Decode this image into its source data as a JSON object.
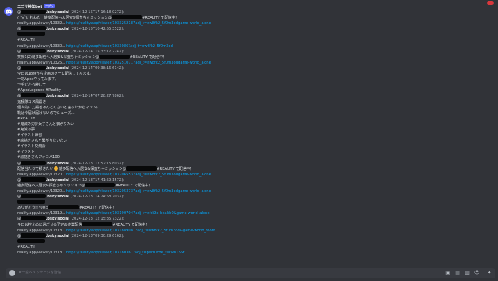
{
  "notification_badge": "",
  "bot": {
    "name": "エゴサ検知bot",
    "badge": "アプリ",
    "time": ""
  },
  "input": {
    "placeholder": "#一般へメッセージを送信"
  },
  "icons": [
    "discord-icon",
    "plus-icon",
    "gift-icon",
    "gif-icon",
    "sticker-icon",
    "emoji-icon",
    "apps-icon"
  ],
  "colors": {
    "accent": "#5865f2",
    "link": "#00a8fc",
    "background": "#313338"
  },
  "messages": [
    {
      "lines": [
        {
          "handle": ".bsky.social",
          "meta": "(2024-12-15T17:16:18.027Z):"
        },
        {
          "text": "( ´∀`)/ おわたー雑多配信へ入居安&探査ちゃミッション@",
          "text2": "#REALITY で配信中！"
        },
        {
          "prefix": "reality.app/viewer/10332...",
          "link": "https://reality.app/viewer/1033252187adj_t=nw8fk2_5f0m3odgame-world_alone"
        },
        {
          "handle": ".bsky.social",
          "meta": "(2024-12-15T10:42:55.352Z):"
        },
        {
          "text": ""
        },
        {
          "text": "#REALITY"
        },
        {
          "prefix": "reality.app/viewer/10330...",
          "link": "https://reality.app/viewer/1033086?adj_t=nw8fk2_5f0m3od"
        }
      ]
    },
    {
      "lines": [
        {
          "handle": ".bsky.social",
          "meta": "(2024-12-14T15:33:17.224Z):"
        },
        {
          "text": "笑顔1(2)雑多配信へ入居安&探査ちゃミッション@",
          "text2": "#REALITY で配信中！"
        },
        {
          "prefix": "reality.app/viewer/10325...",
          "link": "https://reality.app/viewer/1032510717adj_t=nw8fk2_5f0m3odgame-world_alone"
        },
        {
          "handle": ".bsky.social",
          "meta": "(2024-12-14T09:38:16.614Z):"
        },
        {
          "text": "今日は18時から企画のゲーム配信してみます。"
        },
        {
          "text": "一応Apexやってみます。"
        },
        {
          "text": "下手だから許して"
        },
        {
          "text": "#ApexLegends #Reality"
        },
        {
          "handle": ".bsky.social",
          "meta": "(2024-12-14T07:28:27.786Z):"
        },
        {
          "text": "鬼殺隊コス風置き"
        },
        {
          "text": "個人的に刀鍛冶あんどくさいと言ったからマントに"
        },
        {
          "text": "靴は今届け届けないのでシューズ…"
        },
        {
          "text": "#REALITY"
        },
        {
          "text": "#鬼滅の刃夢女子さんと繋がりたい"
        },
        {
          "text": "#鬼滅の夢"
        },
        {
          "text": "#イラスト練習"
        },
        {
          "text": "#絵描きさんと繋がりたいたい"
        },
        {
          "text": "#イラスト交流会"
        },
        {
          "text": "#イラスト"
        },
        {
          "text": "#絵描きさんフォロバ100"
        }
      ]
    },
    {
      "lines": [
        {
          "handle": ".bsky.social",
          "meta": "(2024-12-13T17:52:15.803Z):"
        },
        {
          "text": "配信当たりで頼きたい",
          "emoji": true,
          "text1b": "雑多配信へ入居安&探査ちゃミッション@",
          "text2": "#REALITY で配信中！"
        },
        {
          "prefix": "reality.app/viewer/10320...",
          "link": "https://reality.app/viewer/1032065537adj_t=nw8fk2_5f0m3odgame-world_alone"
        },
        {
          "handle": ".bsky.social",
          "meta": "(2024-12-13T17:41:59.157Z):"
        },
        {
          "text": "雑多配信へ入居安&探査ちゃミッション@",
          "text2": "#REALITY で配信中！"
        },
        {
          "prefix": "reality.app/viewer/10320...",
          "link": "https://reality.app/viewer/1032053737adj_t=nw8fk2_5f0m3odgame-world_alone"
        },
        {
          "handle": ".bsky.social",
          "meta": "(2024-12-13T14:24:58.703Z):"
        },
        {
          "text": ""
        },
        {
          "text": "ありがとう!!700日",
          "text2": "#REALITY で配信中！"
        },
        {
          "prefix": "reality.app/viewer/10319...",
          "link": "https://reality.app/viewer/1031907047adj_t=nfdi9x_health0&game-world_alone"
        },
        {
          "handle": ".bsky.social",
          "meta": "(2024-12-13T12:15:35.732Z):"
        },
        {
          "text": "今日は控えめに過ごせる予定の作業配信",
          "text2": "#REALITY で配信中！"
        },
        {
          "prefix": "reality.app/viewer/10318...",
          "link": "https://reality.app/viewer/1031889081?adj_t=nw8fk2_5f0m3od&game-world_room"
        },
        {
          "handle": ".bsky.social",
          "meta": "(2024-12-13T09:30:29.616Z):"
        },
        {
          "text": ""
        },
        {
          "text": "#REALITY"
        },
        {
          "prefix": "reality.app/viewer/10318...",
          "link": "https://reality.app/viewer/103180361?adj_t=pw3Dcde_t0cwh1i9w"
        }
      ]
    }
  ]
}
